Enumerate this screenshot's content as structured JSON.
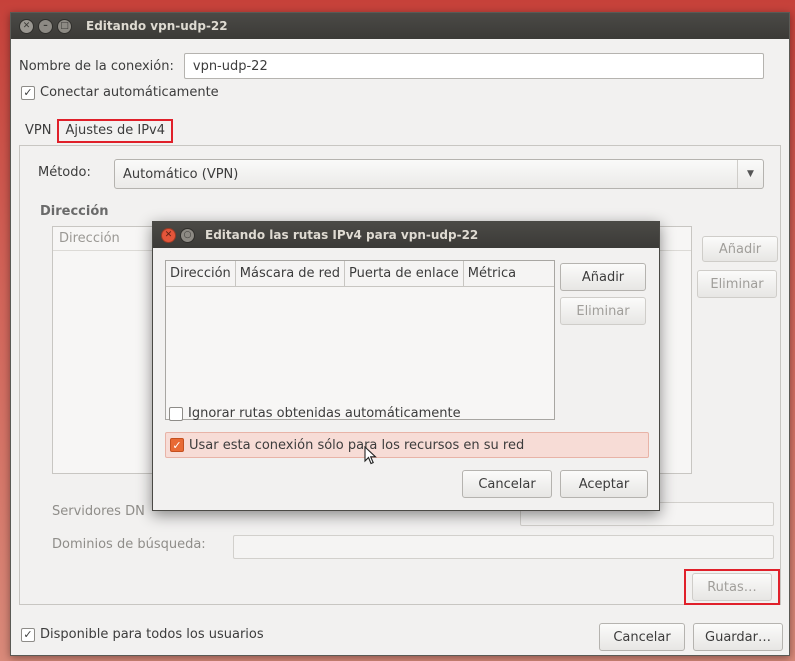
{
  "main_window": {
    "title": "Editando vpn-udp-22",
    "connection_name_label": "Nombre de la conexión:",
    "connection_name_value": "vpn-udp-22",
    "auto_connect_label": "Conectar automáticamente",
    "auto_connect_checked": true,
    "tabs": [
      {
        "label": "VPN",
        "active": false
      },
      {
        "label": "Ajustes de IPv4",
        "active": true
      }
    ],
    "method_label": "Método:",
    "method_value": "Automático (VPN)",
    "address_section_title": "Dirección",
    "address_table_header": "Dirección",
    "add_button": "Añadir",
    "delete_button": "Eliminar",
    "dns_label": "Servidores DN",
    "search_domains_label": "Dominios de búsqueda:",
    "routes_button": "Rutas…",
    "available_all_users_label": "Disponible para todos los usuarios",
    "available_all_users_checked": true,
    "cancel_button": "Cancelar",
    "save_button": "Guardar…"
  },
  "routes_dialog": {
    "title": "Editando las rutas IPv4 para vpn-udp-22",
    "columns": [
      "Dirección",
      "Máscara de red",
      "Puerta de enlace",
      "Métrica"
    ],
    "add_button": "Añadir",
    "delete_button": "Eliminar",
    "ignore_auto_routes_label": "Ignorar rutas obtenidas automáticamente",
    "ignore_auto_routes_checked": false,
    "use_only_for_network_label": "Usar esta conexión sólo para los recursos en su red",
    "use_only_for_network_checked": true,
    "cancel_button": "Cancelar",
    "accept_button": "Aceptar"
  },
  "colors": {
    "highlight_red": "#e0202a",
    "accent_orange": "#e86a35",
    "titlebar": "#3b3a37"
  }
}
